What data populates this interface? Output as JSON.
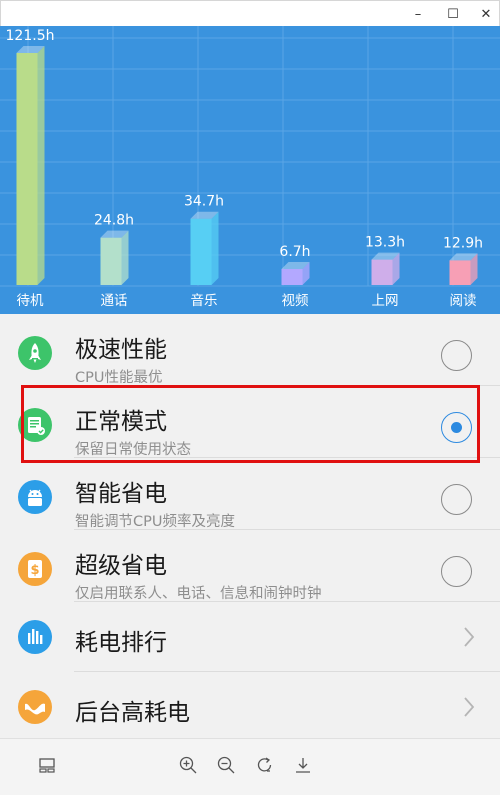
{
  "window": {
    "controls": {
      "minimize": "–",
      "maximize": "☐",
      "close": "✕"
    }
  },
  "chart_data": {
    "type": "bar",
    "categories": [
      "待机",
      "通话",
      "音乐",
      "视频",
      "上网",
      "阅读"
    ],
    "values": [
      121.5,
      24.8,
      34.7,
      6.7,
      13.3,
      12.9
    ],
    "value_labels": [
      "121.5h",
      "24.8h",
      "34.7h",
      "6.7h",
      "13.3h",
      "12.9h"
    ],
    "unit": "h",
    "colors": [
      "#b9dc8a",
      "#b3e0cb",
      "#57cff4",
      "#b3a8ff",
      "#cfaeea",
      "#f79fb5"
    ],
    "background": "#3a93de",
    "grid": true,
    "ylim": [
      0,
      121.5
    ]
  },
  "modes": [
    {
      "title": "极速性能",
      "subtitle": "CPU性能最优",
      "icon": "rocket-icon",
      "icon_color": "#3dc46a",
      "selected": false
    },
    {
      "title": "正常模式",
      "subtitle": "保留日常使用状态",
      "icon": "document-check-icon",
      "icon_color": "#3dc46a",
      "selected": true
    },
    {
      "title": "智能省电",
      "subtitle": "智能调节CPU频率及亮度",
      "icon": "android-icon",
      "icon_color": "#2c9ee8",
      "selected": false
    },
    {
      "title": "超级省电",
      "subtitle": "仅启用联系人、电话、信息和闹钟时钟",
      "icon": "dollar-icon",
      "icon_color": "#f5a53a",
      "selected": false
    }
  ],
  "links": [
    {
      "title": "耗电排行",
      "icon": "bar-chart-icon",
      "icon_color": "#2c9ee8"
    },
    {
      "title": "后台高耗电",
      "icon": "wave-icon",
      "icon_color": "#f5a53a"
    }
  ],
  "toolbar": [
    "layout-icon",
    "zoom-in-icon",
    "zoom-out-icon",
    "rotate-icon",
    "download-icon"
  ],
  "colors": {
    "accent": "#2d8ae0",
    "highlight_border": "#e01010"
  }
}
